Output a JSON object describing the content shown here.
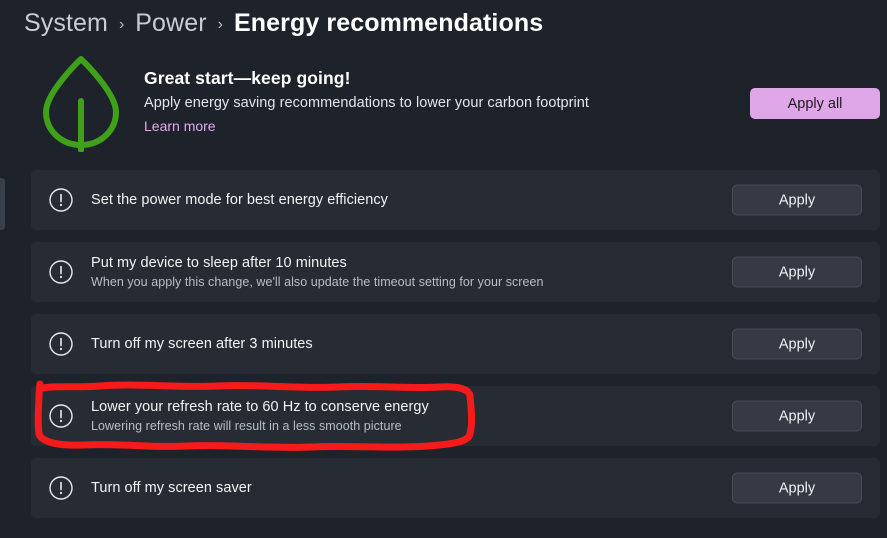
{
  "breadcrumb": {
    "items": [
      "System",
      "Power"
    ],
    "current": "Energy recommendations",
    "separator": "›"
  },
  "hero": {
    "icon": "leaf-icon",
    "title": "Great start—keep going!",
    "subtitle": "Apply energy saving recommendations to lower your carbon footprint",
    "link_label": "Learn more",
    "apply_all_label": "Apply all",
    "apply_all_color": "#dfa6e8",
    "leaf_color": "#3fa11a",
    "link_color": "#e0aee8"
  },
  "recommendations": [
    {
      "icon": "exclamation-circle-icon",
      "title": "Set the power mode for best energy efficiency",
      "description": "",
      "action_label": "Apply",
      "highlighted": false
    },
    {
      "icon": "exclamation-circle-icon",
      "title": "Put my device to sleep after 10 minutes",
      "description": "When you apply this change, we'll also update the timeout setting for your screen",
      "action_label": "Apply",
      "highlighted": false
    },
    {
      "icon": "exclamation-circle-icon",
      "title": "Turn off my screen after 3 minutes",
      "description": "",
      "action_label": "Apply",
      "highlighted": false
    },
    {
      "icon": "exclamation-circle-icon",
      "title": "Lower your refresh rate to 60 Hz to conserve energy",
      "description": "Lowering refresh rate will result in a less smooth picture",
      "action_label": "Apply",
      "highlighted": true
    },
    {
      "icon": "exclamation-circle-icon",
      "title": "Turn off my screen saver",
      "description": "",
      "action_label": "Apply",
      "highlighted": false
    }
  ],
  "annotation": {
    "type": "hand-drawn-rectangle-highlight",
    "color": "#f51b1b",
    "target_index": 3
  },
  "theme": {
    "page_background": "#1e222a",
    "row_background": "#272b33",
    "button_background": "#353a44"
  }
}
